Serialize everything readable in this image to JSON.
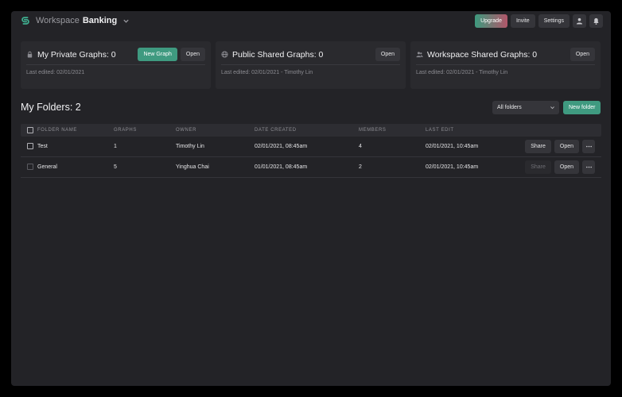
{
  "header": {
    "workspace_label": "Workspace",
    "workspace_name": "Banking",
    "upgrade_label": "Upgrade",
    "invite_label": "Invite",
    "settings_label": "Settings",
    "icons": [
      "user-icon",
      "bell-icon"
    ]
  },
  "cards": {
    "private": {
      "title": "My Private Graphs: 0",
      "new_label": "New Graph",
      "open_label": "Open",
      "last_edited": "Last edited: 02/01/2021",
      "icon": "lock-icon"
    },
    "public": {
      "title": "Public Shared Graphs: 0",
      "open_label": "Open",
      "last_edited": "Last edited: 02/01/2021 - Timothy Lin",
      "icon": "globe-icon"
    },
    "workspace": {
      "title": "Workspace Shared Graphs: 0",
      "open_label": "Open",
      "last_edited": "Last edited: 02/01/2021 - Timothy Lin",
      "icon": "users-icon"
    }
  },
  "folders": {
    "title": "My Folders: 2",
    "filter_value": "All folders",
    "new_folder_label": "New folder",
    "columns": [
      "FOLDER NAME",
      "GRAPHS",
      "OWNER",
      "DATE CREATED",
      "MEMBERS",
      "LAST EDIT"
    ],
    "rows": [
      {
        "name": "Test",
        "graphs": "1",
        "owner": "Timothy Lin",
        "created": "02/01/2021, 08:45am",
        "members": "4",
        "last_edit": "02/01/2021, 10:45am",
        "share_label": "Share",
        "open_label": "Open",
        "share_enabled": true
      },
      {
        "name": "General",
        "graphs": "5",
        "owner": "Yinghua Chai",
        "created": "01/01/2021, 08:45am",
        "members": "2",
        "last_edit": "02/01/2021, 10:45am",
        "share_label": "Share",
        "open_label": "Open",
        "share_enabled": false
      }
    ]
  },
  "colors": {
    "accent": "#3f9a80",
    "upgrade_gradient_end": "#b2566a",
    "background": "#232327",
    "card": "#2a2a2e"
  }
}
